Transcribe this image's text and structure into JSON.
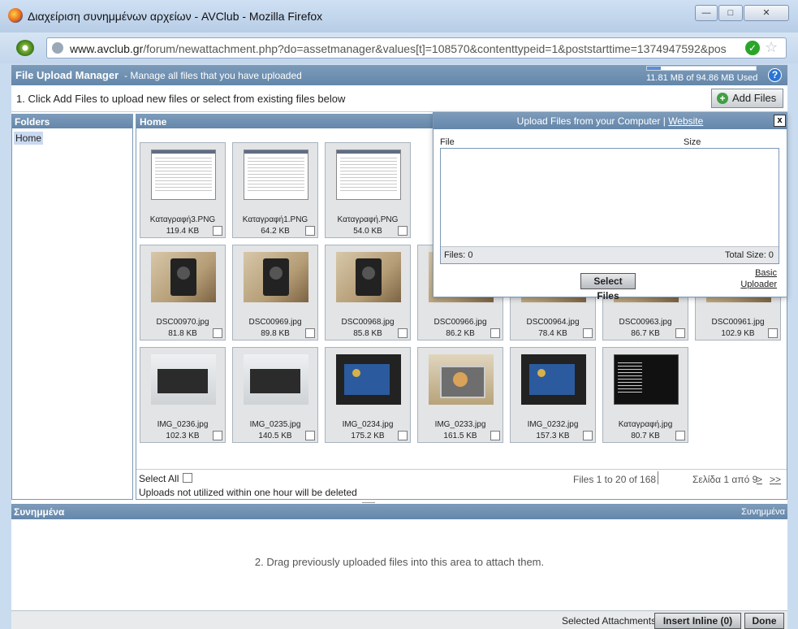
{
  "window": {
    "title": "Διαχείριση συνημμένων αρχείων - AVClub - Mozilla Firefox",
    "url_domain": "www.avclub.gr",
    "url_path": "/forum/newattachment.php?do=assetmanager&values[t]=108570&contenttypeid=1&poststarttime=1374947592&pos"
  },
  "manager": {
    "title": "File Upload Manager",
    "subtitle": "- Manage all files that you have uploaded",
    "quota_text": "11.81 MB of 94.86 MB Used",
    "quota_fraction": 0.124,
    "help": "?",
    "instruction": "1. Click Add Files to upload new files or select from existing files below",
    "add_files": "Add Files"
  },
  "folders": {
    "header": "Folders",
    "items": [
      "Home"
    ]
  },
  "grid": {
    "header": "Home",
    "rows": [
      [
        {
          "name": "Καταγραφή3.PNG",
          "size": "119.4 KB",
          "kind": "ss"
        },
        {
          "name": "Καταγραφή1.PNG",
          "size": "64.2 KB",
          "kind": "ss"
        },
        {
          "name": "Καταγραφή.PNG",
          "size": "54.0 KB",
          "kind": "ss"
        }
      ],
      [
        {
          "name": "DSC00970.jpg",
          "size": "81.8 KB",
          "kind": "spk"
        },
        {
          "name": "DSC00969.jpg",
          "size": "89.8 KB",
          "kind": "spk"
        },
        {
          "name": "DSC00968.jpg",
          "size": "85.8 KB",
          "kind": "spk"
        },
        {
          "name": "DSC00966.jpg",
          "size": "86.2 KB",
          "kind": "spk"
        },
        {
          "name": "DSC00964.jpg",
          "size": "78.4 KB",
          "kind": "spk"
        },
        {
          "name": "DSC00963.jpg",
          "size": "86.7 KB",
          "kind": "spk"
        },
        {
          "name": "DSC00961.jpg",
          "size": "102.9 KB",
          "kind": "spk"
        }
      ],
      [
        {
          "name": "IMG_0236.jpg",
          "size": "102.3 KB",
          "kind": "box"
        },
        {
          "name": "IMG_0235.jpg",
          "size": "140.5 KB",
          "kind": "box"
        },
        {
          "name": "IMG_0234.jpg",
          "size": "175.2 KB",
          "kind": "pcb"
        },
        {
          "name": "IMG_0233.jpg",
          "size": "161.5 KB",
          "kind": "case"
        },
        {
          "name": "IMG_0232.jpg",
          "size": "157.3 KB",
          "kind": "pcb"
        },
        {
          "name": "Καταγραφή.jpg",
          "size": "80.7 KB",
          "kind": "dark"
        }
      ]
    ],
    "select_all": "Select All",
    "warning": "Uploads not utilized within one hour will be deleted",
    "count": "Files 1 to 20 of 168",
    "page": "Σελίδα 1 από 9",
    "next": ">",
    "last": ">>"
  },
  "upload_popup": {
    "title": "Upload Files from your Computer |",
    "website_link": "Website",
    "close": "x",
    "col_file": "File",
    "col_size": "Size",
    "files_count": "Files: 0",
    "total_size": "Total Size: 0",
    "select_files": "Select Files",
    "basic_uploader": "Basic Uploader"
  },
  "attachments": {
    "header": "Συνημμένα",
    "header_right": "Συνημμένα",
    "drag_text": "2. Drag previously uploaded files into this area to attach them.",
    "selected_label": "Selected Attachments:",
    "insert_inline": "Insert Inline (0)",
    "done": "Done"
  }
}
